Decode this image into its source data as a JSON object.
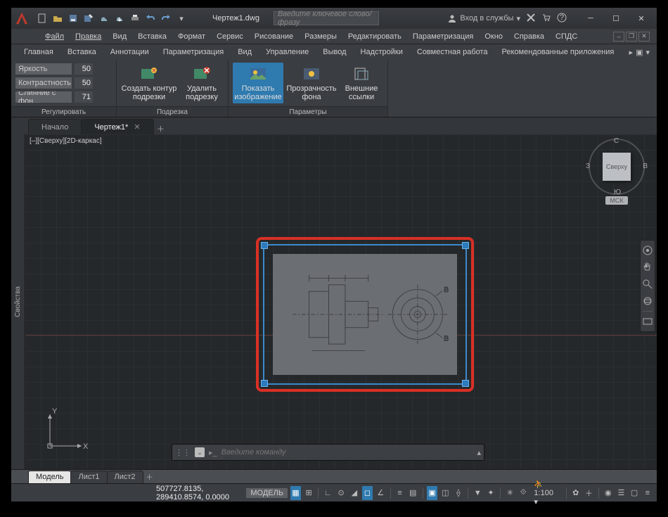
{
  "title": "Чертеж1.dwg",
  "search": {
    "placeholder": "Введите ключевое слово/фразу"
  },
  "signin": "Вход в службы",
  "menu": [
    "Файл",
    "Правка",
    "Вид",
    "Вставка",
    "Формат",
    "Сервис",
    "Рисование",
    "Размеры",
    "Редактировать",
    "Параметризация",
    "Окно",
    "Справка",
    "СПДС"
  ],
  "ribbon_tabs": [
    "Главная",
    "Вставка",
    "Аннотации",
    "Параметризация",
    "Вид",
    "Управление",
    "Вывод",
    "Надстройки",
    "Совместная работа",
    "Рекомендованные приложения"
  ],
  "panels": {
    "adjust": {
      "title": "Регулировать",
      "rows": [
        {
          "label": "Яркость",
          "value": "50"
        },
        {
          "label": "Контрастность",
          "value": "50"
        },
        {
          "label": "Слияние с фон...",
          "value": "71"
        }
      ]
    },
    "crop": {
      "title": "Подрезка",
      "create": "Создать контур подрезки",
      "remove": "Удалить подрезку"
    },
    "options": {
      "title": "Параметры",
      "show": "Показать изображение",
      "transparency": "Прозрачность фона",
      "xref": "Внешние ссылки"
    }
  },
  "doc_tabs": {
    "start": "Начало",
    "drawing": "Чертеж1*"
  },
  "viewlabel": "[–][Сверху][2D-каркас]",
  "viewcube": {
    "top": "Сверху",
    "n": "С",
    "s": "Ю",
    "w": "З",
    "e": "В",
    "wcs": "МСК"
  },
  "side_panel": "Свойства",
  "ucs": {
    "x": "X",
    "y": "Y"
  },
  "cmd": {
    "placeholder": "Введите команду"
  },
  "layout_tabs": [
    "Модель",
    "Лист1",
    "Лист2"
  ],
  "status": {
    "coords": "507727.8135, 289410.8574, 0.0000",
    "model": "МОДЕЛЬ",
    "scale": "1:100"
  }
}
